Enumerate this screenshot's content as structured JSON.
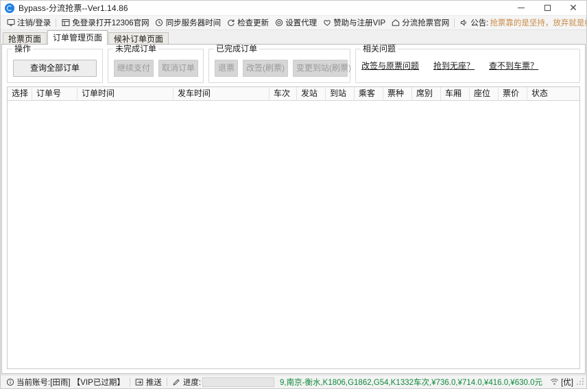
{
  "window": {
    "title": "Bypass-分流抢票--Ver1.14.86",
    "icon": "app-logo-icon",
    "controls": {
      "minimize": "minimize",
      "maximize": "maximize",
      "close": "close"
    }
  },
  "toolbar": {
    "items": [
      {
        "label": "注销/登录",
        "icon": "monitor-icon"
      },
      {
        "label": "免登录打开12306官网",
        "icon": "browser-window-icon"
      },
      {
        "label": "同步服务器时间",
        "icon": "clock-icon"
      },
      {
        "label": "检查更新",
        "icon": "refresh-icon"
      },
      {
        "label": "设置代理",
        "icon": "target-icon"
      },
      {
        "label": "赞助与注册VIP",
        "icon": "heart-icon"
      },
      {
        "label": "分流抢票官网",
        "icon": "home-icon"
      }
    ],
    "announce": {
      "icon": "speaker-icon",
      "label": "公告:",
      "text": "抢票靠的是坚持，放弃就是给别人机会!",
      "color": "#c98b4a"
    }
  },
  "tabs": [
    {
      "label": "抢票页面",
      "active": false
    },
    {
      "label": "订单管理页面",
      "active": true
    },
    {
      "label": "候补订单页面",
      "active": false
    }
  ],
  "groups": {
    "operation": {
      "title": "操作",
      "buttons": [
        {
          "label": "查询全部订单",
          "disabled": false
        }
      ]
    },
    "unfinished": {
      "title": "未完成订单",
      "buttons": [
        {
          "label": "继续支付",
          "disabled": true
        },
        {
          "label": "取消订单",
          "disabled": true
        }
      ]
    },
    "completed": {
      "title": "已完成订单",
      "buttons": [
        {
          "label": "退票",
          "disabled": true
        },
        {
          "label": "改签(刷票)",
          "disabled": true
        },
        {
          "label": "变更到站(刷票)",
          "disabled": true
        }
      ]
    },
    "issues": {
      "title": "相关问题",
      "links": [
        {
          "label": "改签与原票问题"
        },
        {
          "label": "抢到无座？"
        },
        {
          "label": "查不到车票？"
        }
      ]
    }
  },
  "table": {
    "columns": [
      {
        "label": "选择",
        "width": 36
      },
      {
        "label": "订单号",
        "width": 66
      },
      {
        "label": "订单时间",
        "width": 140
      },
      {
        "label": "发车时间",
        "width": 140
      },
      {
        "label": "车次",
        "width": 40
      },
      {
        "label": "发站",
        "width": 42
      },
      {
        "label": "到站",
        "width": 42
      },
      {
        "label": "乘客",
        "width": 42
      },
      {
        "label": "票种",
        "width": 42
      },
      {
        "label": "席别",
        "width": 42
      },
      {
        "label": "车厢",
        "width": 42
      },
      {
        "label": "座位",
        "width": 42
      },
      {
        "label": "票价",
        "width": 42
      },
      {
        "label": "状态",
        "width": 60
      }
    ],
    "rows": []
  },
  "statusbar": {
    "account_icon": "info-icon",
    "account_text": "当前账号:[田雨] 【VIP已过期】",
    "push_icon": "push-icon",
    "push_label": "推送",
    "progress_icon": "pencil-icon",
    "progress_label": "进度:",
    "progress_percent": 0,
    "ticker_text": "9,南京-衡水,K1806,G1862,G54,K1332车次,¥736.0,¥714.0,¥416.0,¥630.0元",
    "ticker_color": "#0f8a3c",
    "network_icon": "wifi-icon",
    "network_badge": "[优]",
    "resize_grip": "resize-grip-icon"
  }
}
